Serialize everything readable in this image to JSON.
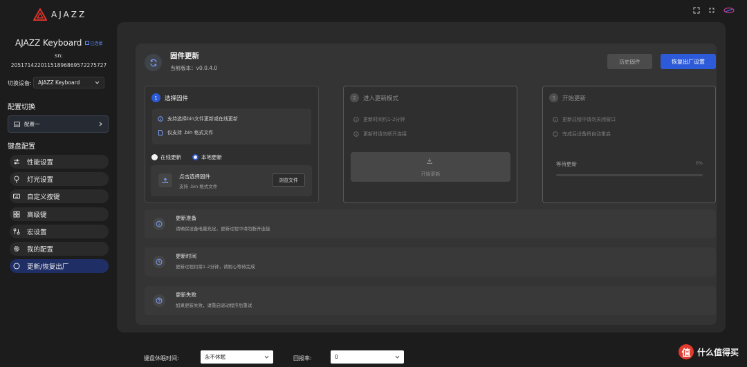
{
  "brand": {
    "name": "AJAZZ"
  },
  "device": {
    "name": "AJAZZ Keyboard",
    "connection": "已连接",
    "sn_label": "sn:",
    "sn_value": "20517142201151896869572275727"
  },
  "device_switch": {
    "label": "切换设备:",
    "selected": "AJAZZ Keyboard"
  },
  "config_section": {
    "title": "配置切换",
    "selected": "配置一"
  },
  "keyboard_section": {
    "title": "键盘配置",
    "items": [
      {
        "label": "性能设置",
        "icon": "sliders-icon"
      },
      {
        "label": "灯光设置",
        "icon": "bulb-icon"
      },
      {
        "label": "自定义按键",
        "icon": "keyboard-icon"
      },
      {
        "label": "高级键",
        "icon": "grid-icon"
      },
      {
        "label": "宏设置",
        "icon": "macro-icon"
      },
      {
        "label": "我的配置",
        "icon": "gear-icon"
      },
      {
        "label": "更新/恢复出厂",
        "icon": "circle-icon"
      }
    ],
    "active_index": 6
  },
  "firmware": {
    "title": "固件更新",
    "version": "当前版本：v0.0.4.0",
    "history_button": "历史固件",
    "reset_button": "恢复出厂设置"
  },
  "steps": [
    {
      "number": "1",
      "title": "选择固件",
      "lines": [
        "支持选择bin文件更新或在线更新",
        "仅支持 .bin 格式文件"
      ],
      "radio_online": "在线更新",
      "radio_local": "本地更新",
      "upload_title": "点击选择固件",
      "upload_sub": "支持 .bin 格式文件",
      "browse_button": "浏览文件"
    },
    {
      "number": "2",
      "title": "进入更新模式",
      "lines": [
        "更新时间约1-2分钟",
        "更新时请勿断开连接"
      ],
      "start_label": "开始更新"
    },
    {
      "number": "3",
      "title": "开始更新",
      "lines": [
        "更新过程中请勿关闭窗口",
        "完成后设备将自动重启"
      ],
      "wait_label": "等待更新",
      "progress_text": "0%",
      "progress": 0
    }
  ],
  "details": [
    {
      "title": "更新准备",
      "desc": "请确保设备电量充足，更新过程中请勿断开连接",
      "icon": "info-icon"
    },
    {
      "title": "更新时间",
      "desc": "更新过程约需1-2分钟，请耐心等待完成",
      "icon": "clock-icon"
    },
    {
      "title": "更新失败",
      "desc": "如果更新失败，请重启驱动程序后重试",
      "icon": "help-icon"
    }
  ],
  "bottom": {
    "sleep_label": "键盘休眠时间:",
    "sleep_value": "永不休眠",
    "report_label": "回报率:",
    "report_value": "0"
  },
  "watermark": {
    "mark": "值",
    "text": "什么值得买"
  },
  "colors": {
    "accent": "#2c5ad9",
    "active_menu": "#1f2f66",
    "brand_red": "#e23a2e"
  }
}
